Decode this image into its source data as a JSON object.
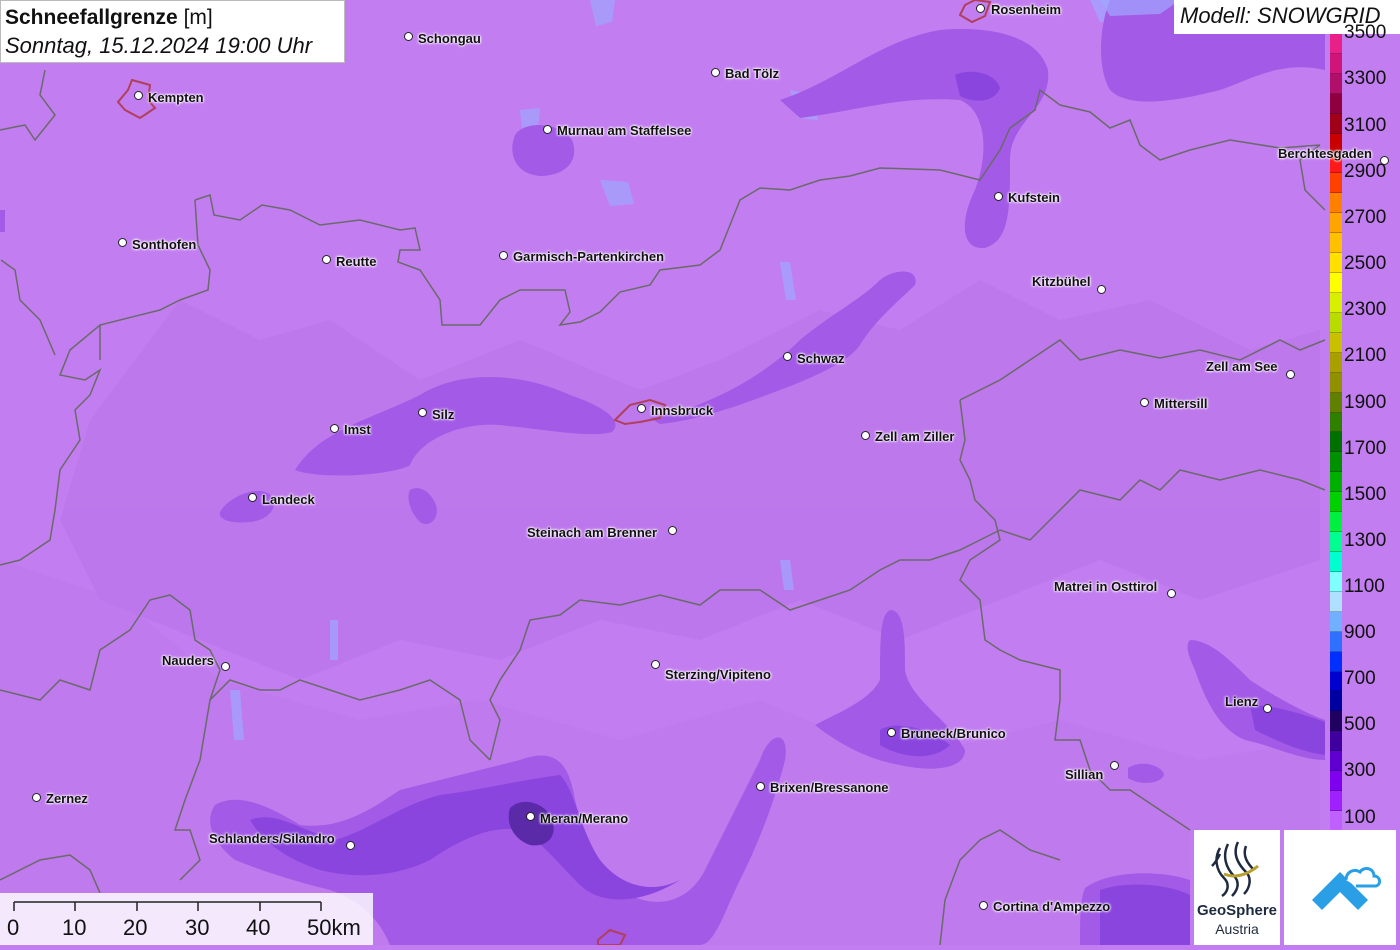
{
  "title": {
    "main": "Schneefallgrenze",
    "unit": "[m]",
    "datetime": "Sonntag, 15.12.2024 19:00 Uhr"
  },
  "model": {
    "label": "Modell: SNOWGRID"
  },
  "legend": {
    "labels": [
      "3500",
      "3300",
      "3100",
      "2900",
      "2700",
      "2500",
      "2300",
      "2100",
      "1900",
      "1700",
      "1500",
      "1300",
      "1100",
      "900",
      "700",
      "500",
      "300",
      "100"
    ],
    "colors": [
      "#e82088",
      "#d0147a",
      "#b0106a",
      "#900040",
      "#a00018",
      "#c80000",
      "#ff1a1a",
      "#ff4000",
      "#ff8000",
      "#ffa500",
      "#ffc000",
      "#ffe000",
      "#ffff00",
      "#d8f000",
      "#b8dc00",
      "#c8c000",
      "#a8a000",
      "#909000",
      "#608000",
      "#308000",
      "#007000",
      "#009000",
      "#00b000",
      "#00d000",
      "#00f040",
      "#00ff90",
      "#00ffd0",
      "#80ffff",
      "#b0e0ff",
      "#70b0ff",
      "#3070ff",
      "#0030ff",
      "#0000d0",
      "#0000a0",
      "#200060",
      "#4000a0",
      "#6000d0",
      "#8000f0",
      "#a020ff",
      "#c060ff"
    ]
  },
  "cities": [
    {
      "name": "Rosenheim"
    },
    {
      "name": "Schongau"
    },
    {
      "name": "Bad Tölz"
    },
    {
      "name": "Kempten"
    },
    {
      "name": "Murnau am Staffelsee"
    },
    {
      "name": "Berchtesgaden"
    },
    {
      "name": "Kufstein"
    },
    {
      "name": "Sonthofen"
    },
    {
      "name": "Reutte"
    },
    {
      "name": "Garmisch-Partenkirchen"
    },
    {
      "name": "Kitzbühel"
    },
    {
      "name": "Schwaz"
    },
    {
      "name": "Zell am See"
    },
    {
      "name": "Mittersill"
    },
    {
      "name": "Silz"
    },
    {
      "name": "Innsbruck"
    },
    {
      "name": "Imst"
    },
    {
      "name": "Zell am Ziller"
    },
    {
      "name": "Landeck"
    },
    {
      "name": "Steinach am Brenner"
    },
    {
      "name": "Matrei in Osttirol"
    },
    {
      "name": "Nauders"
    },
    {
      "name": "Sterzing/Vipiteno"
    },
    {
      "name": "Lienz"
    },
    {
      "name": "Bruneck/Brunico"
    },
    {
      "name": "Sillian"
    },
    {
      "name": "Brixen/Bressanone"
    },
    {
      "name": "Zernez"
    },
    {
      "name": "Meran/Merano"
    },
    {
      "name": "Schlanders/Silandro"
    },
    {
      "name": "Cortina d'Ampezzo"
    }
  ],
  "scale": {
    "labels": [
      "0",
      "10",
      "20",
      "30",
      "40",
      "50km"
    ]
  },
  "logos": {
    "geosphere_line1": "GeoSphere",
    "geosphere_line2": "Austria"
  },
  "colors": {
    "base_field": "#c27ef0",
    "low_field": "#a35ae6",
    "lower_field": "#8a45df",
    "lowest_field": "#5a2aa8",
    "border": "#6a6a6a",
    "water": "#9fa7ff",
    "town_outline": "#b0405a"
  }
}
